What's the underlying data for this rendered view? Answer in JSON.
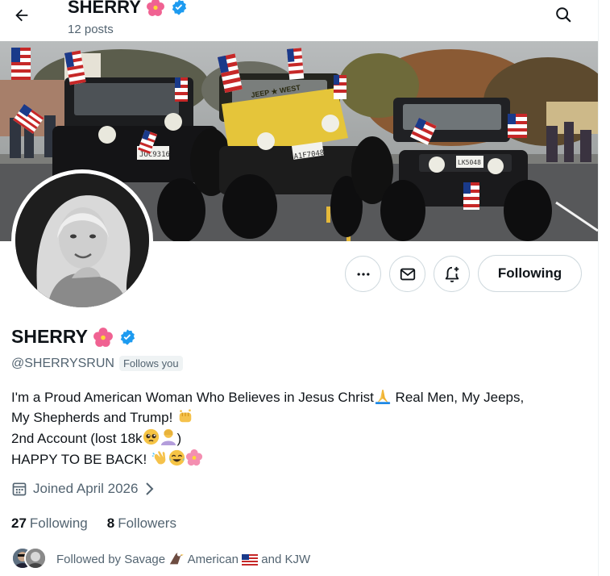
{
  "header": {
    "name": "SHERRY",
    "posts_count": "12 posts",
    "back_icon": "arrow-left-icon",
    "search_icon": "search-icon"
  },
  "profile": {
    "display_name": "SHERRY",
    "handle": "@SHERRYSRUN",
    "follows_you": "Follows you",
    "verified": true,
    "bio": {
      "line1": "I'm a Proud American Woman Who Believes in Jesus Christ",
      "line1b": " Real Men, My Jeeps,",
      "line2": "My Shepherds and Trump! ",
      "line3": "2nd Account (lost 18k",
      "line3b": ")",
      "line4": "HAPPY TO BE BACK! "
    },
    "joined": "Joined April 2026",
    "following_count": "27",
    "following_label": "Following",
    "followers_count": "8",
    "followers_label": "Followers",
    "followed_by": {
      "prefix": "Followed by Savage ",
      "mid": " American ",
      "suffix": " and KJW"
    }
  },
  "actions": {
    "more_icon": "more-horizontal-icon",
    "message_icon": "envelope-icon",
    "notify_icon": "bell-plus-icon",
    "follow_label": "Following"
  },
  "banner": {
    "plate_left": "JOC9316",
    "plate_mid": "A1F7048",
    "plate_right": "LK5048",
    "hood_text": "JEEP ★ WEST"
  },
  "colors": {
    "text": "#0f1419",
    "secondary": "#536471",
    "border": "#cfd9de",
    "verified": "#1d9bf0",
    "hibiscus": "#f06292"
  }
}
